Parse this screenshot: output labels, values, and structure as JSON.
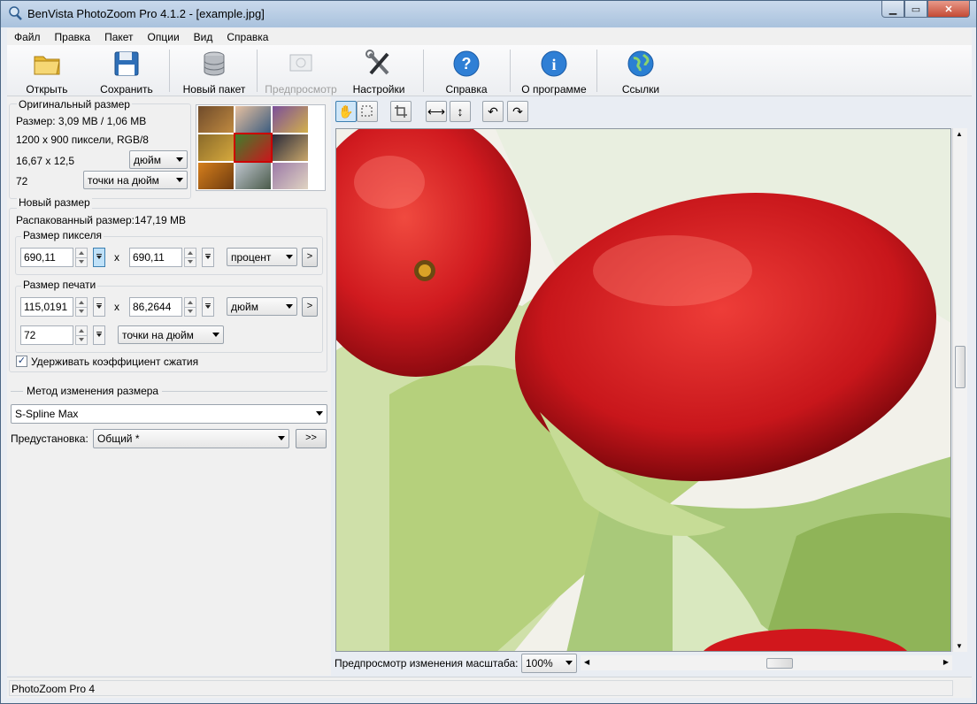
{
  "window": {
    "title": "BenVista PhotoZoom Pro 4.1.2 - [example.jpg]"
  },
  "menu": [
    "Файл",
    "Правка",
    "Пакет",
    "Опции",
    "Вид",
    "Справка"
  ],
  "toolbar": {
    "open": "Открыть",
    "save": "Сохранить",
    "new_batch": "Новый пакет",
    "preview": "Предпросмотр",
    "settings": "Настройки",
    "help": "Справка",
    "about": "О программе",
    "links": "Ссылки"
  },
  "original": {
    "title": "Оригинальный размер",
    "size": "Размер: 3,09 MB / 1,06 MB",
    "pixels": "1200 x 900 пиксели, RGB/8",
    "dims": "16,67 x 12,5",
    "dims_unit": "дюйм",
    "dpi": "72",
    "dpi_unit": "точки на дюйм"
  },
  "new_size": {
    "title": "Новый размер",
    "unpacked": "Распакованный размер:147,19 MB",
    "pixel_group": "Размер пикселя",
    "pixel_w": "690,11",
    "pixel_h": "690,11",
    "pixel_unit": "процент",
    "x_sep": "x",
    "print_group": "Размер печати",
    "print_w": "115,0191",
    "print_h": "86,2644",
    "print_unit": "дюйм",
    "res": "72",
    "res_unit": "точки на дюйм",
    "keep_ratio": "Удерживать коэффициент сжатия",
    "keep_ratio_checked": true,
    "go_btn": ">"
  },
  "method": {
    "title": "Метод изменения размера",
    "algorithm": "S-Spline Max",
    "preset_label": "Предустановка:",
    "preset": "Общий *",
    "more_btn": ">>"
  },
  "view": {
    "zoom_label": "Предпросмотр изменения масштаба:",
    "zoom": "100%"
  },
  "status": {
    "text": "PhotoZoom Pro 4"
  },
  "colors": {
    "titlebar": "#b9cde4",
    "panel": "#f0f0f0",
    "tomato": "#c8161b",
    "lettuce": "#a9c97a"
  }
}
